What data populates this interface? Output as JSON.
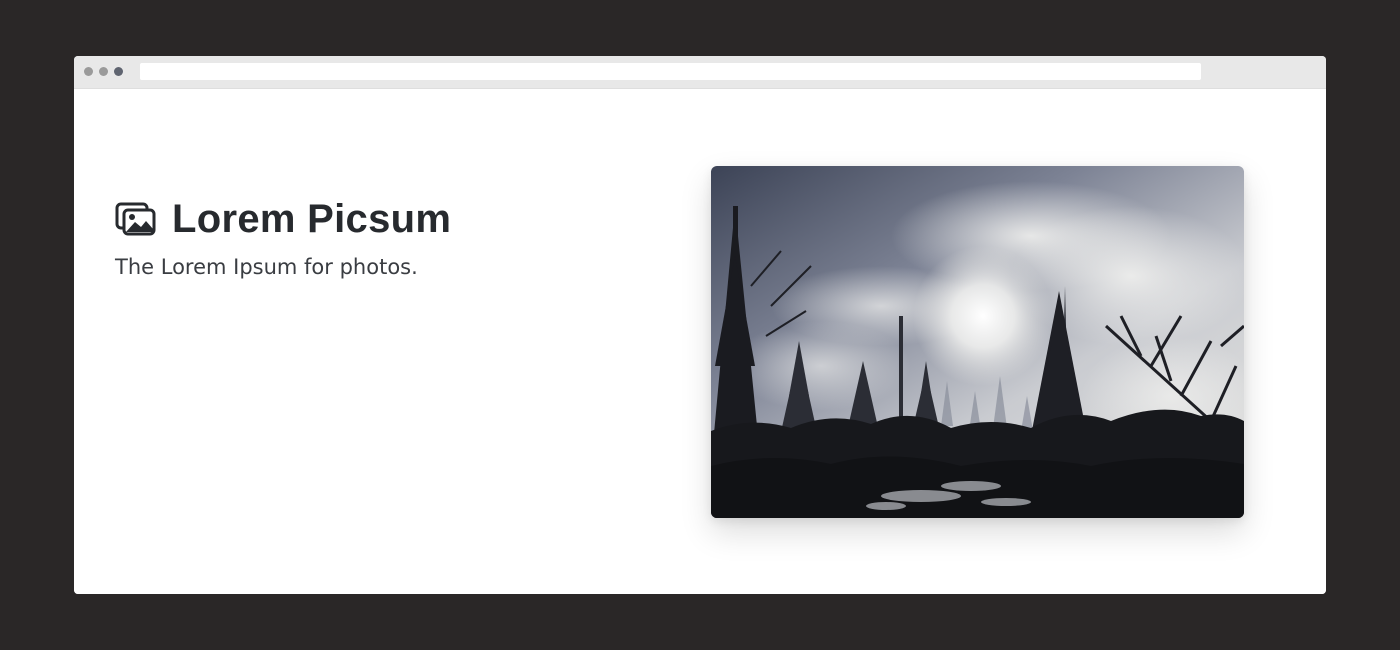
{
  "browser": {
    "address_value": ""
  },
  "hero": {
    "title": "Lorem Picsum",
    "tagline": "The Lorem Ipsum for photos.",
    "logo_icon": "images-icon"
  },
  "photo": {
    "subject": "misty-forest-silhouette"
  },
  "colors": {
    "page_background": "#2a2727",
    "window_background": "#ffffff",
    "titlebar": "#e8e8e8",
    "title_text": "#272a2e"
  }
}
